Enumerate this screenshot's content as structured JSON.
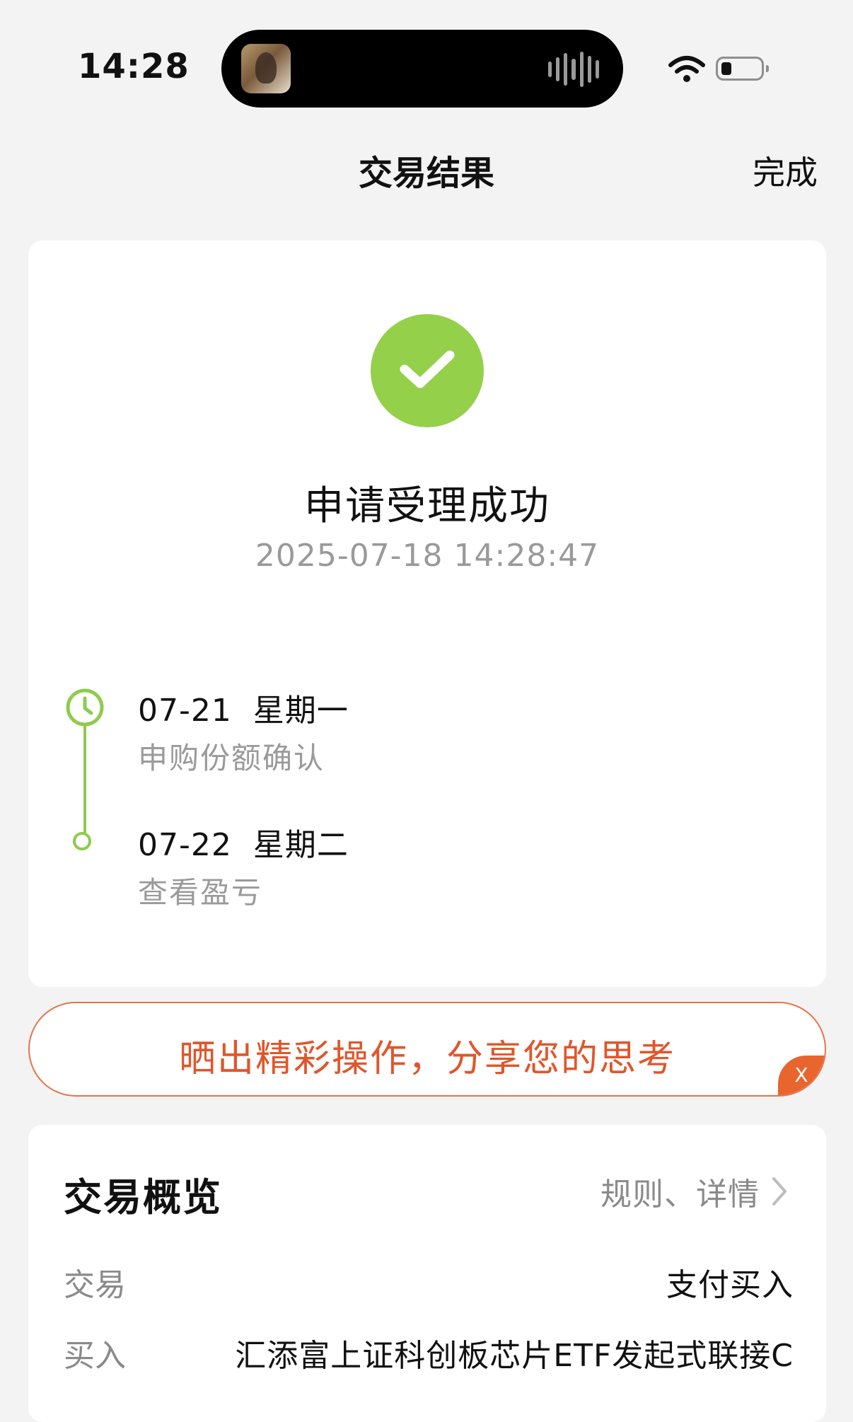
{
  "status_bar": {
    "time": "14:28"
  },
  "nav": {
    "title": "交易结果",
    "done_label": "完成"
  },
  "result": {
    "title": "申请受理成功",
    "timestamp": "2025-07-18 14:28:47",
    "status_color": "#94d04a"
  },
  "timeline": [
    {
      "date": "07-21  星期一",
      "desc": "申购份额确认",
      "icon": "clock-icon"
    },
    {
      "date": "07-22  星期二",
      "desc": "查看盈亏",
      "icon": "dot-icon"
    }
  ],
  "share_banner": {
    "text": "晒出精彩操作，分享您的思考",
    "close_label": "X",
    "accent_color": "#e0562b"
  },
  "overview": {
    "title": "交易概览",
    "link_label": "规则、详情",
    "rows": [
      {
        "label": "交易",
        "value": "支付买入"
      },
      {
        "label": "买入",
        "value": "汇添富上证科创板芯片ETF发起式联接C"
      }
    ]
  }
}
